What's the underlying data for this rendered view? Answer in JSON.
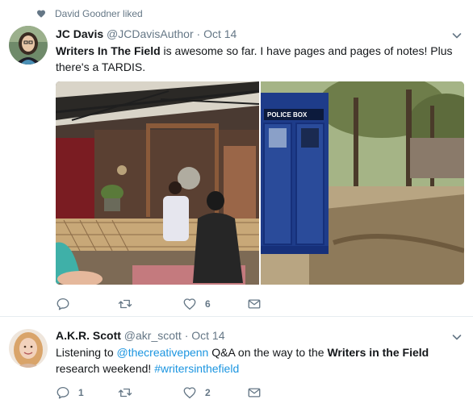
{
  "social_context": {
    "text": "David Goodner liked"
  },
  "tweets": [
    {
      "fullname": "JC Davis",
      "username": "@JCDavisAuthor",
      "separator": "·",
      "time": "Oct 14",
      "text_bold": "Writers In The Field",
      "text_rest1": " is awesome so far. I have pages and pages of notes! Plus",
      "text_rest2": "there's a TARDIS.",
      "photos": [
        {
          "description": "Author speaking on outdoor stage"
        },
        {
          "description": "Police box in wooded area"
        }
      ],
      "tardis_sign": "POLICE BOX",
      "actions": {
        "reply": "",
        "retweet": "",
        "like": "6",
        "dm": ""
      }
    },
    {
      "fullname": "A.K.R. Scott",
      "username": "@akr_scott",
      "separator": "·",
      "time": "Oct 14",
      "text_pre": "Listening to ",
      "mention": "@thecreativepenn",
      "text_mid": " Q&A on the way to the ",
      "text_bold": "Writers in the Field",
      "text_line2": "research weekend! ",
      "hashtag": "#writersinthefield",
      "actions": {
        "reply": "1",
        "retweet": "",
        "like": "2",
        "dm": ""
      }
    }
  ],
  "colors": {
    "text": "#14171a",
    "secondary": "#657786",
    "link": "#1b95e0",
    "divider": "#e6ecf0"
  },
  "icons": [
    "heart-icon",
    "caret-down-icon",
    "reply-icon",
    "retweet-icon",
    "like-icon",
    "direct-message-icon"
  ]
}
